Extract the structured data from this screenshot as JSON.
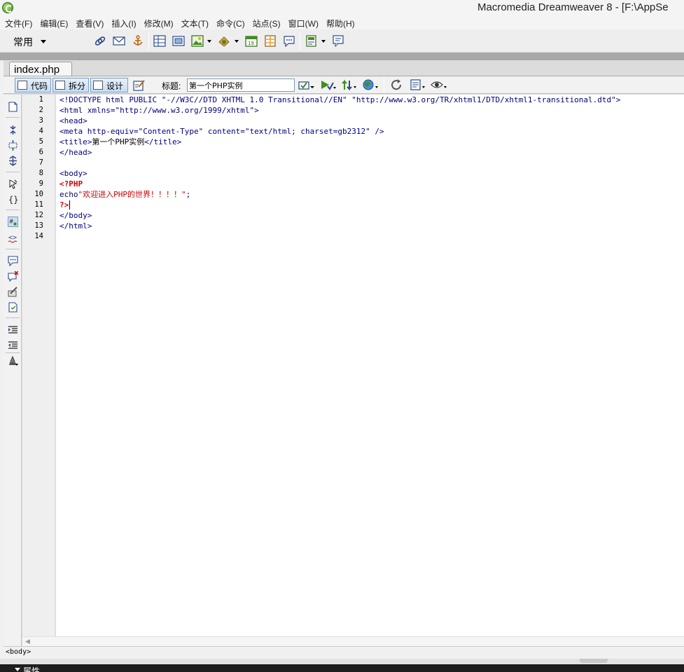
{
  "window": {
    "title": "Macromedia Dreamweaver 8 - [F:\\AppSe"
  },
  "menu": {
    "items": [
      {
        "label": "文件(F)"
      },
      {
        "label": "编辑(E)"
      },
      {
        "label": "查看(V)"
      },
      {
        "label": "插入(I)"
      },
      {
        "label": "修改(M)"
      },
      {
        "label": "文本(T)"
      },
      {
        "label": "命令(C)"
      },
      {
        "label": "站点(S)"
      },
      {
        "label": "窗口(W)"
      },
      {
        "label": "帮助(H)"
      }
    ]
  },
  "insert_bar": {
    "category": "常用"
  },
  "document": {
    "tab_label": "index.php",
    "views": {
      "code": "代码",
      "split": "拆分",
      "design": "设计"
    },
    "title_label": "标题:",
    "title_value": "第一个PHP实例"
  },
  "editor": {
    "line_numbers": [
      "1",
      "2",
      "3",
      "4",
      "5",
      "6",
      "7",
      "8",
      "9",
      "10",
      "11",
      "12",
      "13",
      "14"
    ],
    "lines": {
      "l1": "<!DOCTYPE html PUBLIC \"-//W3C//DTD XHTML 1.0 Transitional//EN\" \"http://www.w3.org/TR/xhtml1/DTD/xhtml1-transitional.dtd\">",
      "l2": "<html xmlns=\"http://www.w3.org/1999/xhtml\">",
      "l3": "<head>",
      "l4": "<meta http-equiv=\"Content-Type\" content=\"text/html; charset=gb2312\" />",
      "l5_open": "<title>",
      "l5_text": "第一个PHP实例",
      "l5_close": "</title>",
      "l6": "</head>",
      "l8": "<body>",
      "l9": "<?PHP",
      "l10_kw": "echo",
      "l10_str": "\"欢迎进入PHP的世界！！！！\"",
      "l10_end": ";",
      "l11": "?>",
      "l12": "</body>",
      "l13": "</html>"
    }
  },
  "status_bar": {
    "tag_selector": "<body>"
  },
  "properties_panel": {
    "label": "属性"
  }
}
